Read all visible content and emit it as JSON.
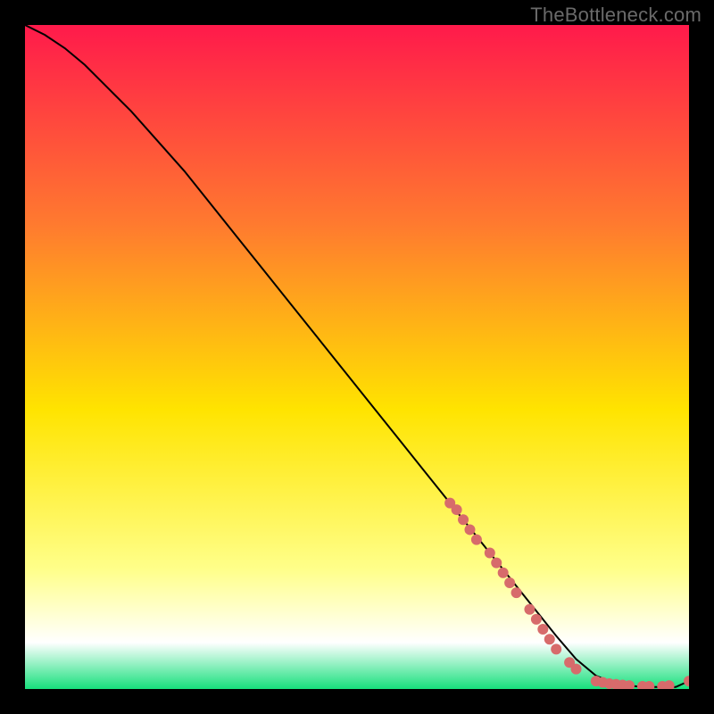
{
  "watermark": "TheBottleneck.com",
  "chart_data": {
    "type": "line",
    "title": "",
    "xlabel": "",
    "ylabel": "",
    "xlim": [
      0,
      100
    ],
    "ylim": [
      0,
      100
    ],
    "grid": false,
    "background_gradient": {
      "top": "#ff1a4b",
      "mid_high": "#ff7a2f",
      "mid": "#ffe400",
      "mid_low": "#ffff8a",
      "low": "#ffffff",
      "bottom": "#17e07c"
    },
    "series": [
      {
        "name": "bottleneck-curve",
        "x": [
          0,
          3,
          6,
          9,
          12,
          16,
          20,
          24,
          28,
          32,
          36,
          40,
          44,
          48,
          52,
          56,
          60,
          64,
          68,
          72,
          76,
          80,
          83,
          86,
          89,
          92,
          95,
          98,
          100
        ],
        "y": [
          100,
          98.5,
          96.5,
          94,
          91,
          87,
          82.5,
          78,
          73,
          68,
          63,
          58,
          53,
          48,
          43,
          38,
          33,
          28,
          23,
          18,
          13,
          8,
          4.5,
          2,
          0.8,
          0.4,
          0.3,
          0.3,
          1.2
        ],
        "stroke": "#000000",
        "stroke_width": 2
      }
    ],
    "markers": [
      {
        "name": "highlighted-points",
        "color": "#d76b6b",
        "radius": 6,
        "points": [
          {
            "x": 64,
            "y": 28
          },
          {
            "x": 65,
            "y": 27
          },
          {
            "x": 66,
            "y": 25.5
          },
          {
            "x": 67,
            "y": 24
          },
          {
            "x": 68,
            "y": 22.5
          },
          {
            "x": 70,
            "y": 20.5
          },
          {
            "x": 71,
            "y": 19
          },
          {
            "x": 72,
            "y": 17.5
          },
          {
            "x": 73,
            "y": 16
          },
          {
            "x": 74,
            "y": 14.5
          },
          {
            "x": 76,
            "y": 12
          },
          {
            "x": 77,
            "y": 10.5
          },
          {
            "x": 78,
            "y": 9
          },
          {
            "x": 79,
            "y": 7.5
          },
          {
            "x": 80,
            "y": 6
          },
          {
            "x": 82,
            "y": 4
          },
          {
            "x": 83,
            "y": 3
          },
          {
            "x": 86,
            "y": 1.2
          },
          {
            "x": 87,
            "y": 1
          },
          {
            "x": 88,
            "y": 0.8
          },
          {
            "x": 89,
            "y": 0.7
          },
          {
            "x": 90,
            "y": 0.6
          },
          {
            "x": 91,
            "y": 0.5
          },
          {
            "x": 93,
            "y": 0.4
          },
          {
            "x": 94,
            "y": 0.4
          },
          {
            "x": 96,
            "y": 0.4
          },
          {
            "x": 97,
            "y": 0.5
          },
          {
            "x": 100,
            "y": 1.2
          }
        ]
      }
    ]
  }
}
